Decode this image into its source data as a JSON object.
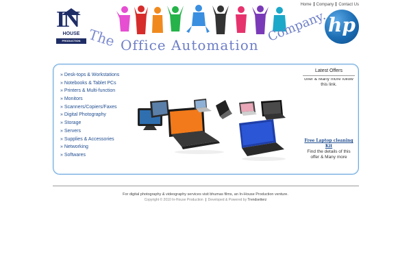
{
  "nav": {
    "home": "Home",
    "company": "Company",
    "contact": "Contact Us"
  },
  "header": {
    "logo_letters": "IN",
    "logo_house": "HOUSE",
    "logo_production": "PRODUCTION",
    "tagline_the": "The",
    "tagline_office": "Office Automation",
    "tagline_company": "Company.",
    "hp_logo": "hp"
  },
  "categories": [
    "» Desk-tops & Workstations",
    "» Notebooks & Tablet PCs",
    "» Printers & Multi-function",
    "» Monitors",
    "» Scanners/Copiers/Faxes",
    "» Digital Photography",
    "» Storage",
    "» Servers",
    "» Supplies & Accessories",
    "» Networking",
    "» Softwares"
  ],
  "offers": {
    "title": "Latest Offers",
    "snippet_top": "offer & Many more follow this link.",
    "offer_link": "Free Laptop cleaning Kit",
    "offer_desc": "Find the details of this offer & Many more"
  },
  "footer": {
    "line1": "For digital photography & videography services visit bhumas films, an In-House Production venture.",
    "copyright": "Copyright © 2010 In-House Production",
    "developed": "Developed & Powered by",
    "developer": "Trendsetterz"
  },
  "colors": {
    "link_blue": "#1f4c8f",
    "panel_border": "#6aa7dd",
    "brand_navy": "#1f2d66",
    "hp_blue": "#1b6db3"
  }
}
